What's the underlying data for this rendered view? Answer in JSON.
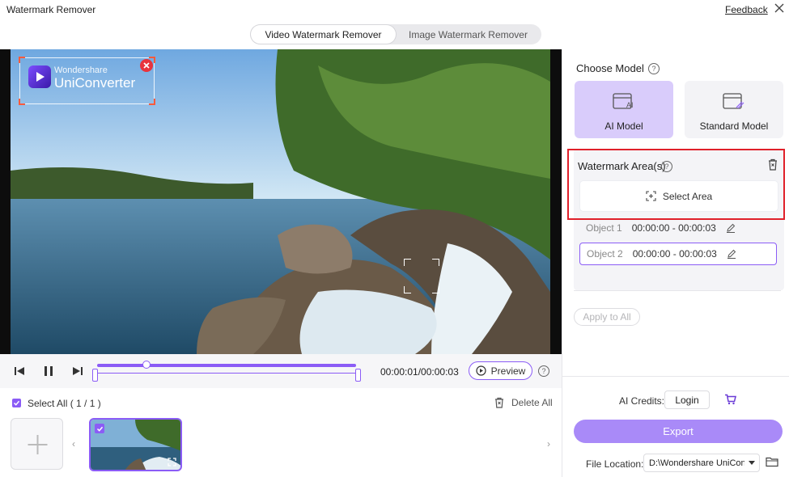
{
  "app": {
    "title": "Watermark Remover",
    "feedback": "Feedback"
  },
  "tabs": [
    {
      "label": "Video Watermark Remover",
      "active": true
    },
    {
      "label": "Image Watermark Remover",
      "active": false
    }
  ],
  "video": {
    "watermark_brand_top": "Wondershare",
    "watermark_brand_main": "UniConverter"
  },
  "player": {
    "time": "00:00:01/00:00:03",
    "preview": "Preview",
    "progress": 0.19
  },
  "files": {
    "select_all": "Select All ( 1 / 1 )",
    "delete_all": "Delete All"
  },
  "sidebar": {
    "choose_model": "Choose Model",
    "models": [
      {
        "label": "AI Model",
        "selected": true
      },
      {
        "label": "Standard Model",
        "selected": false
      }
    ],
    "watermark_areas": "Watermark Area(s)",
    "select_area": "Select Area",
    "objects": [
      {
        "name": "Object 1",
        "time": "00:00:00 - 00:00:03",
        "active": false
      },
      {
        "name": "Object 2",
        "time": "00:00:00 - 00:00:03",
        "active": true
      }
    ],
    "apply_all": "Apply to All",
    "ai_credits": "AI Credits:",
    "login": "Login",
    "export": "Export",
    "file_location_label": "File Location:",
    "file_location_value": "D:\\Wondershare UniCon"
  },
  "colors": {
    "accent": "#8b5cf6",
    "highlight": "#e0202a",
    "export": "#a98af8"
  }
}
